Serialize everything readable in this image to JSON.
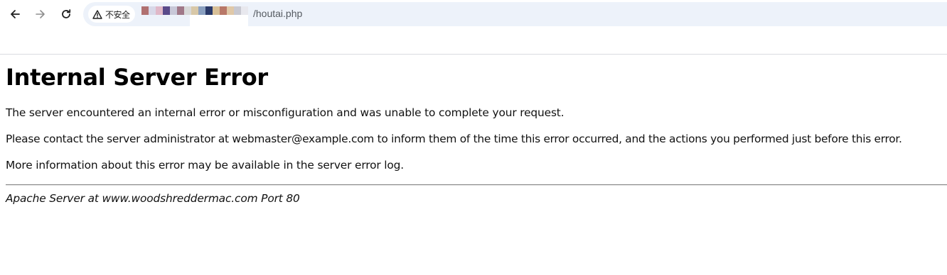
{
  "browser": {
    "nav": {
      "back_icon": "arrow-left-icon",
      "forward_icon": "arrow-right-icon",
      "reload_icon": "reload-icon"
    },
    "address_bar": {
      "security_icon": "warning-triangle-icon",
      "security_label": "不安全",
      "url_visible_path": "/houtai.php",
      "redacted_colors": [
        "#b07070",
        "#d8d8e8",
        "#e0b8c8",
        "#5a4a8a",
        "#c8c8d8",
        "#a07888",
        "#d8d8d8",
        "#d8c8a8",
        "#8aa0c0",
        "#2a3a6a",
        "#d8c098",
        "#b87868",
        "#e0c8a8",
        "#c8c8d0",
        "#e8e8ee"
      ],
      "background_color": "#edf2fa"
    }
  },
  "page": {
    "heading": "Internal Server Error",
    "paragraphs": [
      "The server encountered an internal error or misconfiguration and was unable to complete your request.",
      "Please contact the server administrator at webmaster@example.com to inform them of the time this error occurred, and the actions you performed just before this error.",
      "More information about this error may be available in the server error log."
    ],
    "server_signature": "Apache Server at www.woodshreddermac.com Port 80"
  }
}
